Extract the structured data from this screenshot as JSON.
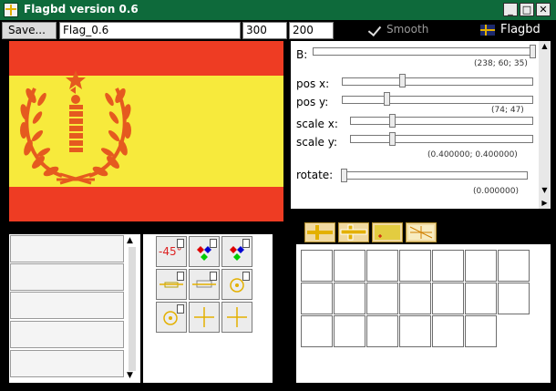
{
  "window": {
    "title": "Flagbd version 0.6",
    "controls": {
      "minimize": "_",
      "maximize": "□",
      "close": "✕"
    }
  },
  "toolbar": {
    "save_label": "Save...",
    "name_value": "Flag_0.6",
    "width_value": "300",
    "height_value": "200",
    "smooth_label": "Smooth",
    "brand_label": "Flagbd"
  },
  "controls_panel": {
    "b_label": "B:",
    "color_value": "(238; 60; 35)",
    "pos_x_label": "pos  x:",
    "pos_y_label": "pos  y:",
    "pos_value": "(74; 47)",
    "scale_x_label": "scale x:",
    "scale_y_label": "scale y:",
    "scale_value": "(0.400000; 0.400000)",
    "rotate_label": "rotate:",
    "rotate_value": "(0.000000)"
  },
  "tools_panel": {
    "rotate_tool_label": "-45°"
  },
  "colors": {
    "red": "#ee3c23",
    "yellow": "#f7ea3c",
    "emblem": "#e55a1f",
    "titlebar": "#0e6a3b"
  }
}
